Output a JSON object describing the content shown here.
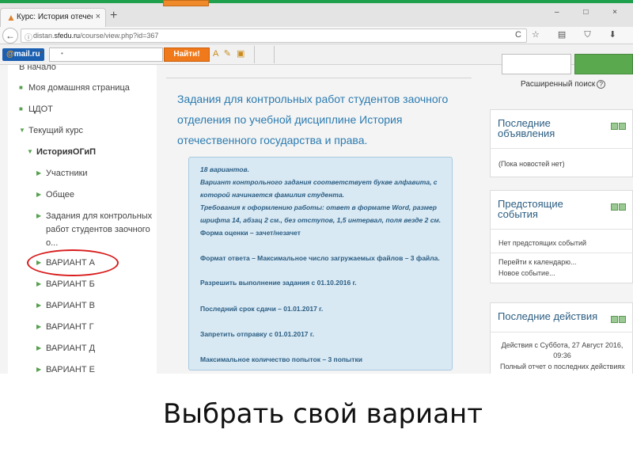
{
  "browser": {
    "tab_title": "Курс: История отечестве...",
    "tab_close": "×",
    "new_tab": "+",
    "window_controls": "– □ ×",
    "url_host": "distan.sfedu.ru",
    "url_prefix": "distan.",
    "url_domain": "sfedu.ru",
    "url_path": "/course/view.php?id=367",
    "back": "←",
    "reload": "C",
    "nav_icons": "☆ ▤ ⛉ ⬇ ➤ ≡"
  },
  "mail_toolbar": {
    "logo_at": "@",
    "logo_text": "mail",
    "logo_dot_ru": ".ru",
    "dropdown": "▾",
    "search_mark": "•",
    "find_label": "Найти!",
    "tools": "A ✎ ▣"
  },
  "left_nav": {
    "items": [
      {
        "label": "В начало",
        "bullet": ""
      },
      {
        "label": "Моя домашняя страница",
        "bullet": "■"
      },
      {
        "label": "ЦДОТ",
        "bullet": "■"
      },
      {
        "label": "Текущий курс",
        "bullet": "▼"
      },
      {
        "label": "ИсторияОГиП",
        "bullet": "▼"
      },
      {
        "label": "Участники",
        "bullet": "▶"
      },
      {
        "label": "Общее",
        "bullet": "▶"
      },
      {
        "label_lines": [
          "Задания для контрольных",
          "работ студентов заочного",
          "о..."
        ],
        "bullet": "▶"
      },
      {
        "label": "ВАРИАНТ А",
        "bullet": "▶"
      },
      {
        "label": "ВАРИАНТ Б",
        "bullet": "▶"
      },
      {
        "label": "ВАРИАНТ В",
        "bullet": "▶"
      },
      {
        "label": "ВАРИАНТ Г",
        "bullet": "▶"
      },
      {
        "label": "ВАРИАНТ Д",
        "bullet": "▶"
      },
      {
        "label": "ВАРИАНТ Е",
        "bullet": "▶"
      }
    ]
  },
  "assignment": {
    "title_lines": [
      "Задания для контрольных работ студентов заочного",
      "отделения по учебной дисциплине История",
      "отечественного государства и права."
    ],
    "description": [
      "18 вариантов.",
      "Вариант контрольного задания соответствует букве алфавита, с",
      "которой начинается фамилия студента.",
      "Требования к оформлению работы: ответ в формате Word, размер",
      "шрифта 14, абзац 2 см., без отступов, 1,5 интервал, поля везде 2 см.",
      "Форма оценки – зачет/незачет",
      "Формат ответа – Максимальное число загружаемых файлов – 3 файла.",
      "Разрешить выполнение задания с 01.10.2016 г.",
      "Последний срок сдачи – 01.01.2017 г.",
      "Запретить отправку с 01.01.2017 г.",
      "Максимальное количество попыток – 3 попытки"
    ]
  },
  "right_col": {
    "advanced_search": "Расширенный поиск",
    "help_mark": "?",
    "news": {
      "title_lines": [
        "Последние",
        "объявления"
      ],
      "empty": "(Пока новостей нет)"
    },
    "events": {
      "title_lines": [
        "Предстоящие",
        "события"
      ],
      "none": "Нет предстоящих событий",
      "calendar_link": "Перейти к календарю...",
      "new_event_link": "Новое событие..."
    },
    "activity": {
      "title": "Последние действия",
      "since_lines": [
        "Действия с Суббота, 27 Август 2016,",
        "09:36"
      ],
      "full_report": "Полный отчет о последних действиях"
    }
  },
  "caption": "Выбрать свой вариант",
  "colors": {
    "accent_blue": "#2b7bb0",
    "highlight_circle": "#d81e1e",
    "nav_green": "#56a04e",
    "find_orange": "#f07a1b"
  }
}
